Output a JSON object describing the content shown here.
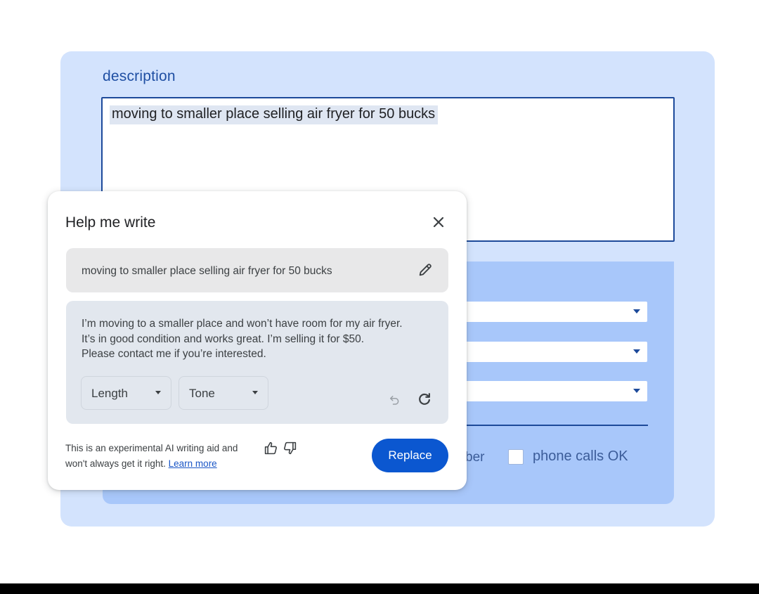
{
  "form": {
    "description_label": "description",
    "description_value": "moving to smaller place selling air fryer for 50 bucks",
    "partial_label": "ber",
    "phone_calls_label": "phone calls OK",
    "phone_calls_checked": false
  },
  "dialog": {
    "title": "Help me write",
    "prompt": "moving to smaller place selling air fryer for 50 bucks",
    "result_lines": [
      "I’m moving to a smaller place and won’t have room for my air fryer.",
      "It’s in good condition and works great. I’m selling it for $50.",
      "Please contact me if you’re interested."
    ],
    "length_label": "Length",
    "tone_label": "Tone",
    "disclaimer_line1": "This is an experimental AI writing aid and",
    "disclaimer_line2": "won't always get it right.",
    "learn_more": "Learn more",
    "replace_label": "Replace"
  },
  "icons": {
    "close": "close-icon",
    "edit": "pencil-icon",
    "undo": "undo-icon",
    "regenerate": "refresh-icon",
    "thumbs_up": "thumbs-up-icon",
    "thumbs_down": "thumbs-down-icon",
    "dropdown": "caret-down-icon"
  },
  "colors": {
    "panel_bg": "#d3e3fd",
    "form_area_bg": "#a8c7fa",
    "accent": "#0b57d0",
    "field_border": "#1d4a9a",
    "label_text": "#1f4fa3"
  }
}
